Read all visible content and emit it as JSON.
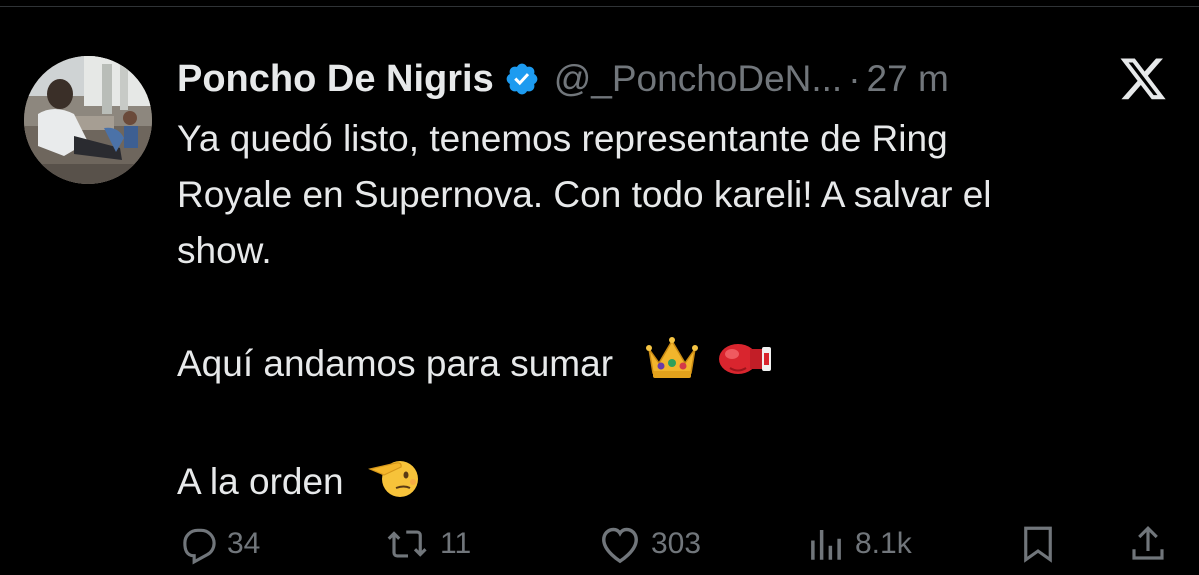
{
  "author": {
    "display_name": "Poncho De Nigris",
    "handle": "@_PonchoDeN...",
    "separator": "·",
    "time": "27 m",
    "verified": true,
    "avatar_icon": "profile-photo",
    "verified_color": "#1d9bf0"
  },
  "brand": {
    "logo_icon": "x-logo-icon"
  },
  "tweet": {
    "lines": [
      "Ya quedó listo, tenemos representante de Ring",
      "Royale en Supernova. Con todo kareli! A salvar el",
      "show."
    ],
    "line2": "Aquí andamos para sumar",
    "line2_emojis": [
      "crown-emoji",
      "boxing-glove-emoji"
    ],
    "line3": "A la orden",
    "line3_emojis": [
      "saluting-face-emoji"
    ]
  },
  "actions": {
    "reply": {
      "icon": "reply-icon",
      "count": "34"
    },
    "retweet": {
      "icon": "retweet-icon",
      "count": "11"
    },
    "like": {
      "icon": "heart-icon",
      "count": "303"
    },
    "views": {
      "icon": "views-icon",
      "count": "8.1k"
    },
    "bookmark": {
      "icon": "bookmark-icon"
    },
    "share": {
      "icon": "share-icon"
    }
  },
  "colors": {
    "background": "#000000",
    "text_primary": "#e7e9ea",
    "text_secondary": "#71767b"
  }
}
